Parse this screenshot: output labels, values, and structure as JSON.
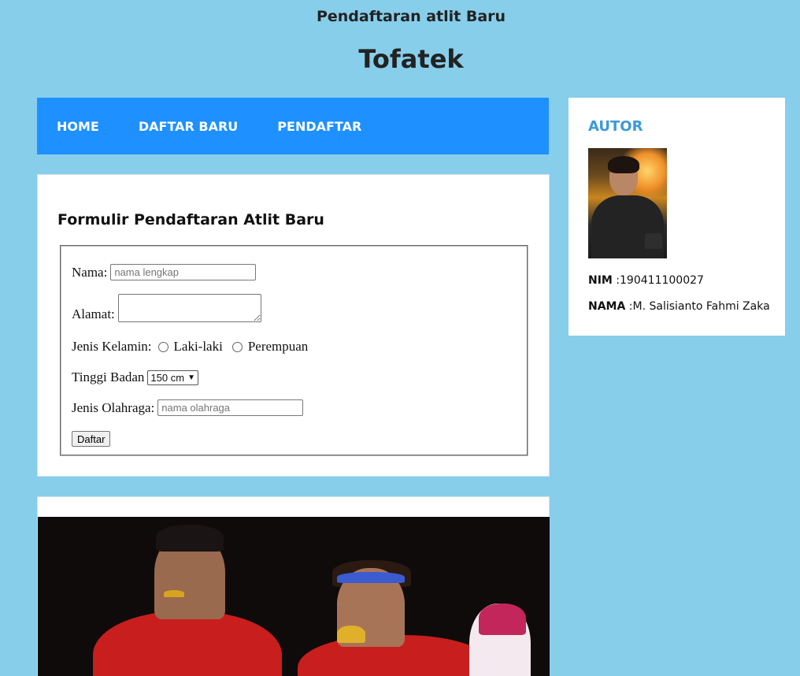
{
  "header": {
    "subtitle": "Pendaftaran atlit Baru",
    "title": "Tofatek"
  },
  "nav": {
    "items": [
      {
        "label": "HOME"
      },
      {
        "label": "DAFTAR BARU"
      },
      {
        "label": "PENDAFTAR"
      }
    ]
  },
  "form": {
    "heading": "Formulir Pendaftaran Atlit Baru",
    "nama_label": "Nama:",
    "nama_placeholder": "nama lengkap",
    "alamat_label": "Alamat:",
    "jk_label": "Jenis Kelamin:",
    "jk_options": [
      "Laki-laki",
      "Perempuan"
    ],
    "tinggi_label": "Tinggi Badan",
    "tinggi_value": "150 cm",
    "olahraga_label": "Jenis Olahraga:",
    "olahraga_placeholder": "nama olahraga",
    "submit_label": "Daftar"
  },
  "sidebar": {
    "heading": "AUTOR",
    "nim_label": "NIM",
    "nim_value": " :190411100027",
    "nama_label": "NAMA",
    "nama_value": " :M. Salisianto Fahmi Zaka"
  },
  "colors": {
    "background": "#87ceeb",
    "nav": "#1e90ff",
    "autor_heading": "#3a9ad9"
  }
}
